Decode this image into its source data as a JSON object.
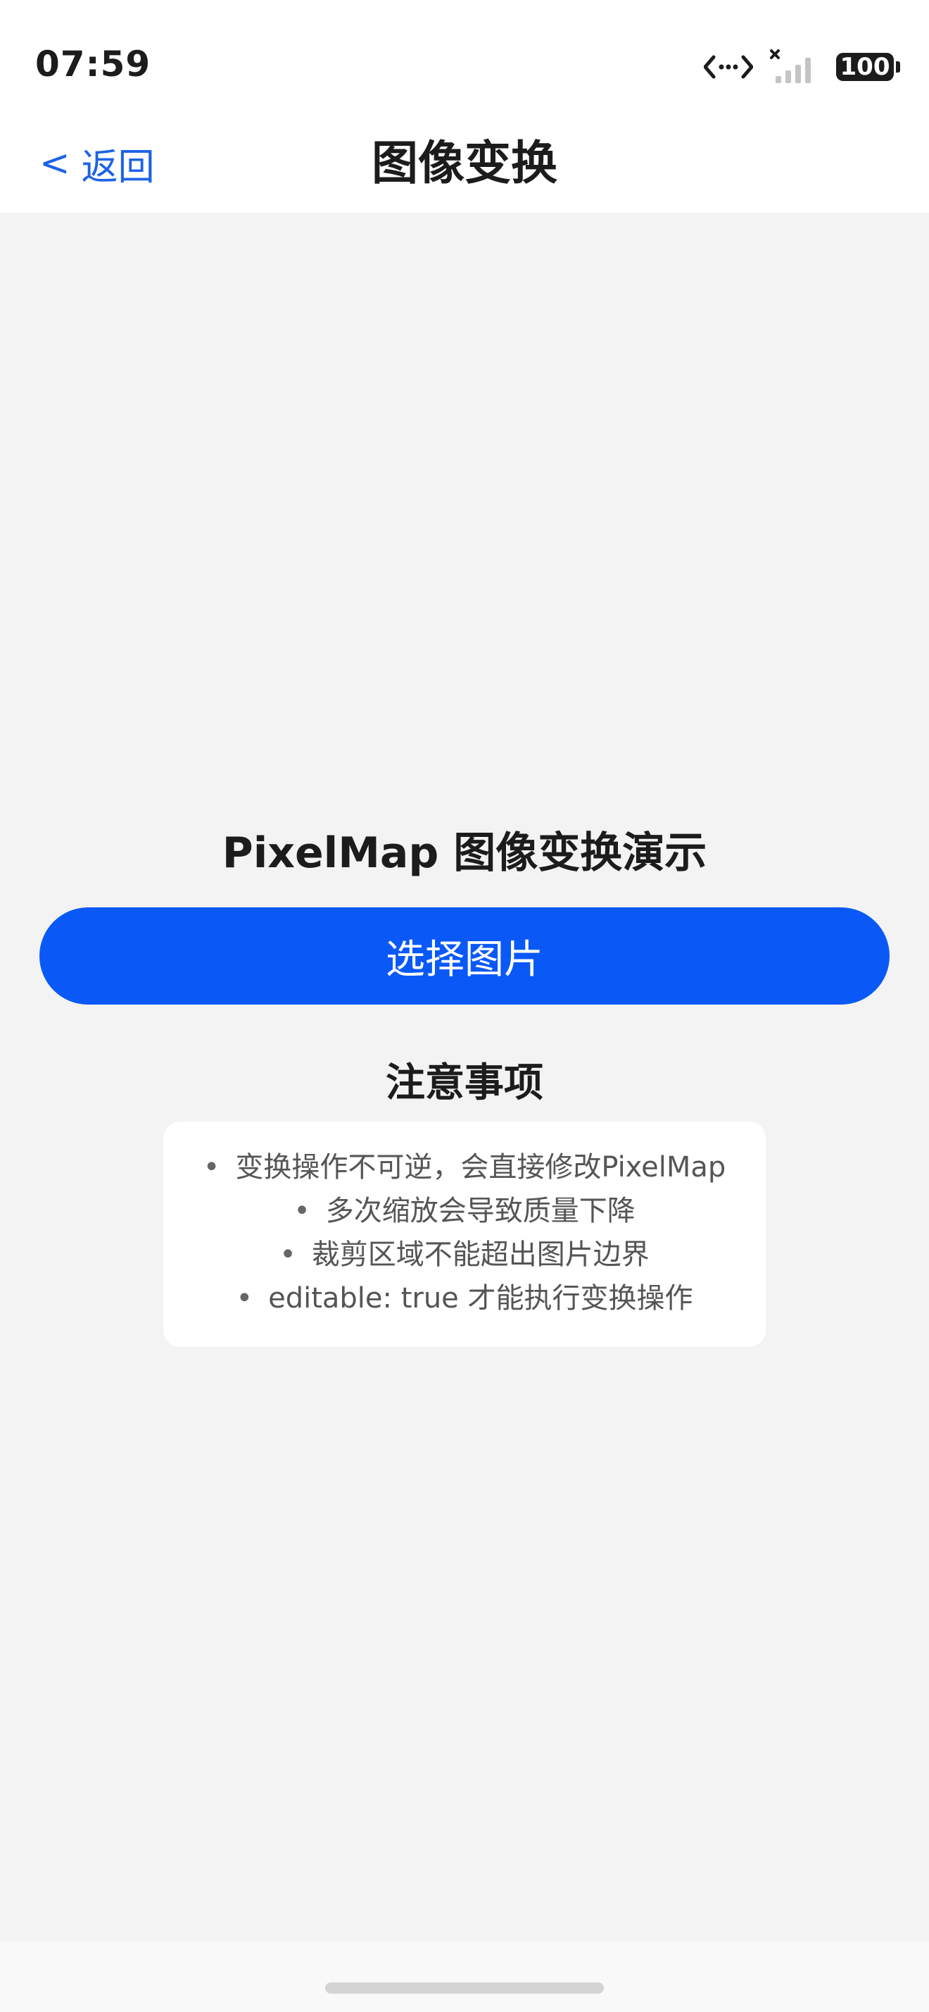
{
  "status_bar": {
    "time": "07:59",
    "icons": [
      "link-icon",
      "no-signal-icon",
      "battery-icon"
    ],
    "battery": "100"
  },
  "nav": {
    "back_chevron": "<",
    "back_label": "返回",
    "title": "图像变换"
  },
  "main": {
    "demo_title": "PixelMap 图像变换演示",
    "select_button": "选择图片",
    "notes_title": "注意事项",
    "notes": [
      "变换操作不可逆，会直接修改PixelMap",
      "多次缩放会导致质量下降",
      "裁剪区域不能超出图片边界",
      "editable: true 才能执行变换操作"
    ]
  },
  "colors": {
    "accent": "#0a59f7",
    "back_text": "#1e63e6",
    "background": "#f3f3f3",
    "card": "#ffffff"
  }
}
